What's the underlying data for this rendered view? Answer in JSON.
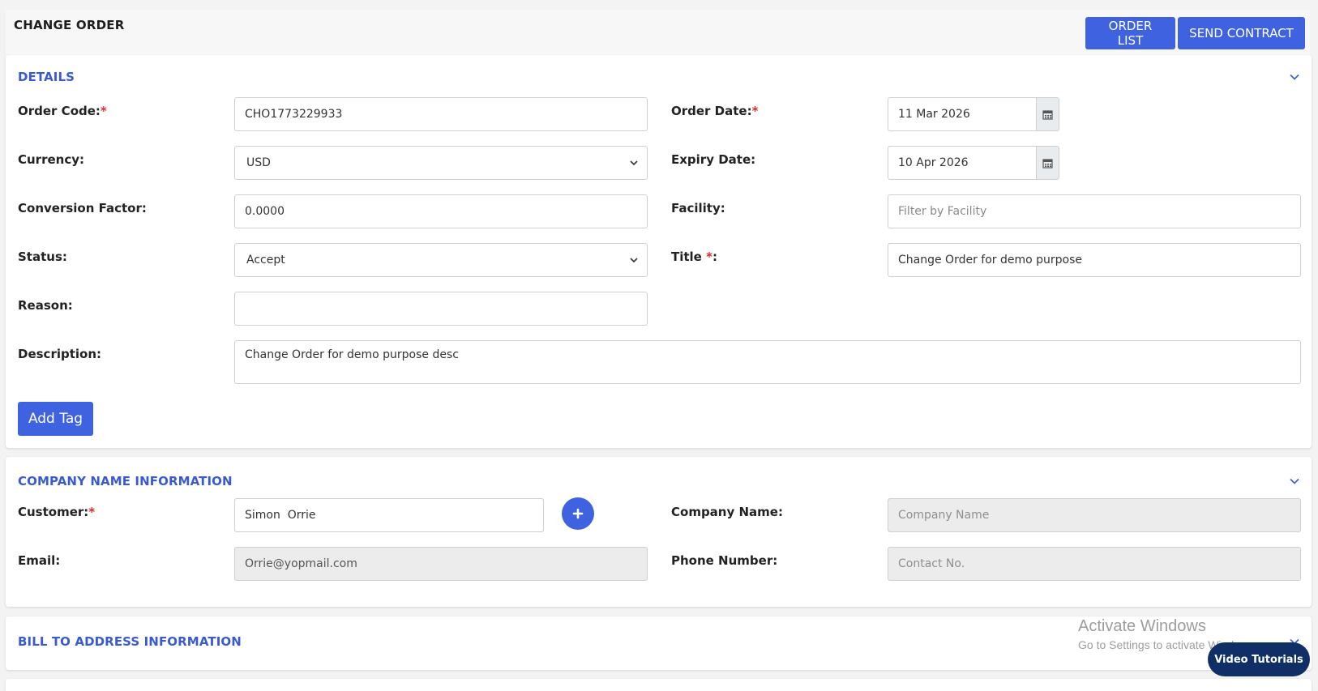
{
  "header": {
    "title": "CHANGE ORDER",
    "order_list_label": "ORDER LIST",
    "send_contract_label": "SEND CONTRACT"
  },
  "details": {
    "section_title": "DETAILS",
    "order_code": {
      "label": "Order Code:",
      "required": "*",
      "value": "CHO1773229933"
    },
    "currency": {
      "label": "Currency:",
      "value": "USD"
    },
    "conversion_factor": {
      "label": "Conversion Factor:",
      "value": "0.0000"
    },
    "status": {
      "label": "Status:",
      "value": "Accept"
    },
    "reason": {
      "label": "Reason:",
      "value": ""
    },
    "description": {
      "label": "Description:",
      "value": "Change Order for demo purpose desc"
    },
    "order_date": {
      "label": "Order Date:",
      "required": "*",
      "value": "11 Mar 2026"
    },
    "expiry_date": {
      "label": "Expiry Date:",
      "value": "10 Apr 2026"
    },
    "facility": {
      "label": "Facility:",
      "placeholder": "Filter by Facility"
    },
    "title": {
      "label": "Title ",
      "required": "*",
      "suffix": ":",
      "value": "Change Order for demo purpose"
    },
    "add_tag_label": "Add Tag"
  },
  "company": {
    "section_title": "COMPANY NAME INFORMATION",
    "customer": {
      "label": "Customer:",
      "required": "*",
      "value": "Simon  Orrie"
    },
    "email": {
      "label": "Email:",
      "value": "Orrie@yopmail.com"
    },
    "company_name": {
      "label": "Company Name:",
      "placeholder": "Company Name"
    },
    "phone": {
      "label": "Phone Number:",
      "placeholder": "Contact No."
    }
  },
  "bill_to": {
    "section_title": "BILL TO ADDRESS INFORMATION"
  },
  "watermark": {
    "title": "Activate Windows",
    "subtitle": "Go to Settings to activate Windows."
  },
  "video_tutorials_label": "Video Tutorials",
  "colors": {
    "primary": "#3f63e0",
    "section_title": "#3a5ad1",
    "required": "#e02b2b",
    "video_button": "#0f2f66"
  }
}
